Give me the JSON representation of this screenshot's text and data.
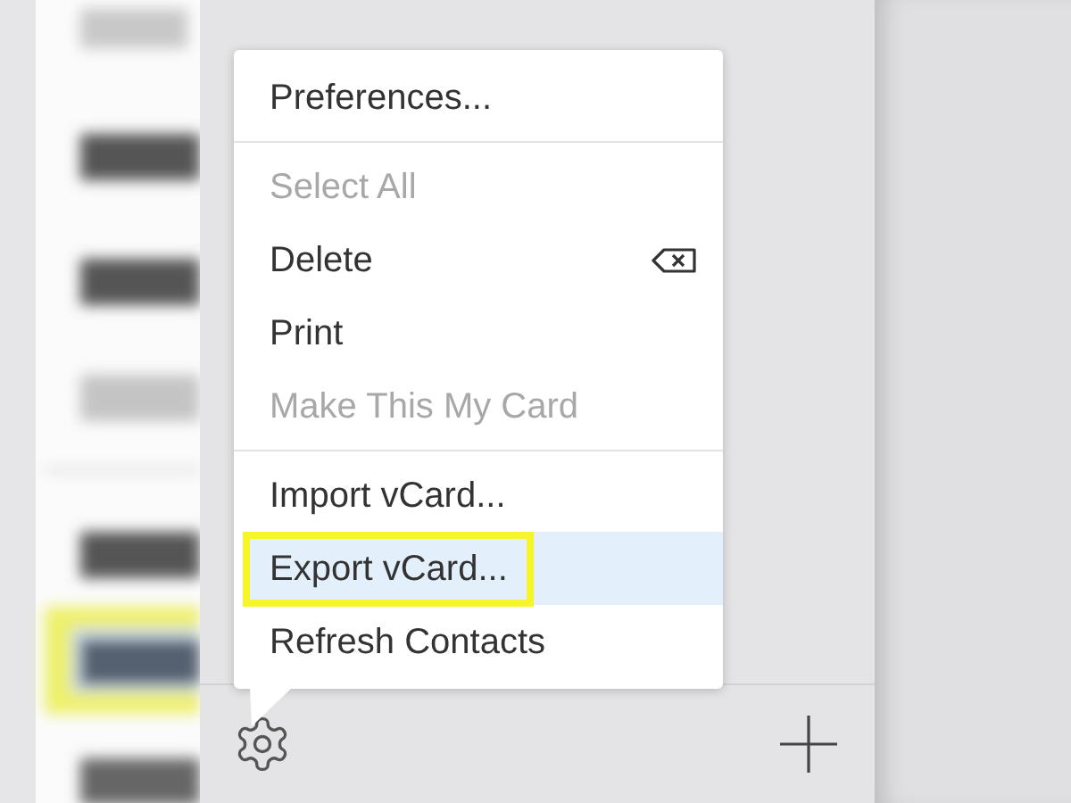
{
  "menu": {
    "items": [
      {
        "kind": "item",
        "label": "Preferences...",
        "disabled": false,
        "selected": false,
        "outlined": false
      },
      {
        "kind": "separator"
      },
      {
        "kind": "item",
        "label": "Select All",
        "disabled": true,
        "selected": false,
        "outlined": false
      },
      {
        "kind": "item",
        "label": "Delete",
        "disabled": false,
        "selected": false,
        "outlined": false,
        "delete_key_icon": true
      },
      {
        "kind": "item",
        "label": "Print",
        "disabled": false,
        "selected": false,
        "outlined": false
      },
      {
        "kind": "item",
        "label": "Make This My Card",
        "disabled": true,
        "selected": false,
        "outlined": false
      },
      {
        "kind": "separator"
      },
      {
        "kind": "item",
        "label": "Import vCard...",
        "disabled": false,
        "selected": false,
        "outlined": false
      },
      {
        "kind": "item",
        "label": "Export vCard...",
        "disabled": false,
        "selected": true,
        "outlined": true
      },
      {
        "kind": "item",
        "label": "Refresh Contacts",
        "disabled": false,
        "selected": false,
        "outlined": false
      }
    ]
  }
}
